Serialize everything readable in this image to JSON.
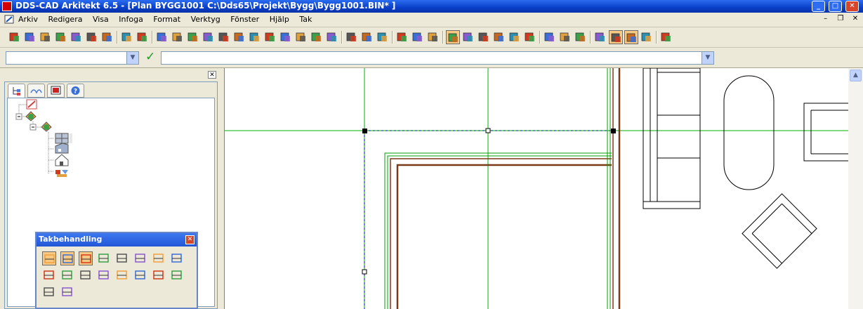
{
  "window": {
    "title": "DDS-CAD Arkitekt 6.5 - [Plan  BYGG1001  C:\\Dds65\\Projekt\\Bygg\\Bygg1001.BIN* ]"
  },
  "window_controls": {
    "minimize": "_",
    "maximize": "□",
    "close": "✕"
  },
  "menu": [
    "Arkiv",
    "Redigera",
    "Visa",
    "Infoga",
    "Format",
    "Verktyg",
    "Fönster",
    "Hjälp",
    "Tak"
  ],
  "mdi_controls": {
    "minimize": "–",
    "restore": "❐",
    "close": "✕"
  },
  "input_bar": {
    "combo1_value": "",
    "combo2_value": "",
    "dropdown_arrow": "▼",
    "confirm": "✓"
  },
  "panel": {
    "close": "✕"
  },
  "floating_toolbar": {
    "title": "Takbehandling",
    "close": "✕"
  },
  "scroll": {
    "up": "▲"
  },
  "icons": {
    "toolbar": [
      "new-icon",
      "open-icon",
      "save-icon",
      "close-file-icon",
      "print-icon",
      "undo-icon",
      "redo-icon",
      "globe-icon",
      "render-icon",
      "help-icon",
      "house-icon",
      "arch-icon",
      "roof-edit-icon",
      "window-icon",
      "roof-icon",
      "stair-icon",
      "fire-icon",
      "hatch-icon",
      "object-icon",
      "section-icon",
      "paint-icon",
      "flag-icon",
      "symbol-icon",
      "tools-icon",
      "edit-icon",
      "eye-icon",
      "search-icon",
      "grid-icon",
      "house-3d-icon",
      "building-icon",
      "copy-icon",
      "layers-icon",
      "export-icon",
      "text-icon",
      "image-icon",
      "delete-icon",
      "table-icon",
      "roof-select-icon",
      "roof-dots-icon",
      "roof-warning-icon",
      "window-list-icon"
    ],
    "tabs": [
      "tree-tab-icon",
      "layers-tab-icon",
      "display-tab-icon",
      "help-tab-icon"
    ],
    "floating": [
      "roof-1-icon",
      "roof-2-icon",
      "roof-3-icon",
      "roof-4-icon",
      "roof-5-icon",
      "roof-6-icon",
      "roof-7-icon",
      "roof-8-icon",
      "roof-9-icon",
      "roof-10-icon",
      "roof-11-icon",
      "roof-12-icon",
      "roof-13-icon",
      "roof-14-icon",
      "roof-15-icon",
      "roof-16-icon",
      "roof-17-icon",
      "roof-18-icon"
    ]
  },
  "colors": {
    "title_blue": "#0a3fc9",
    "selected_tool": "#f7c982",
    "guide_green": "#00b000",
    "wall_brown": "#7a3b1a",
    "selection_blue": "#0000c0"
  }
}
